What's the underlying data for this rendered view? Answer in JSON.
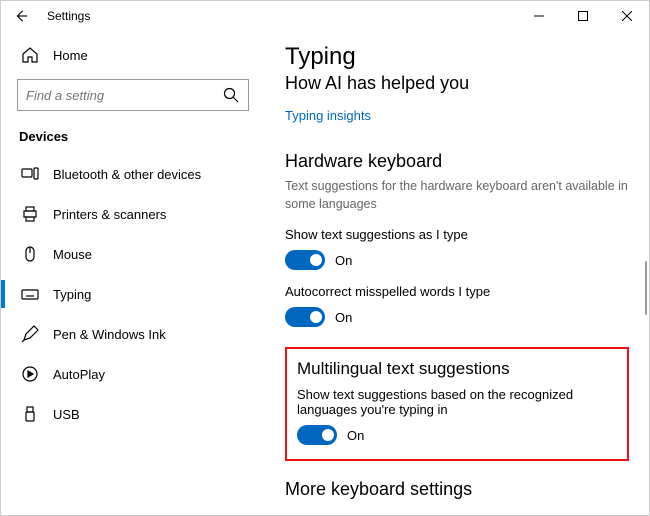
{
  "app": {
    "title": "Settings"
  },
  "sidebar": {
    "home_label": "Home",
    "search_placeholder": "Find a setting",
    "group_title": "Devices",
    "items": [
      {
        "label": "Bluetooth & other devices"
      },
      {
        "label": "Printers & scanners"
      },
      {
        "label": "Mouse"
      },
      {
        "label": "Typing"
      },
      {
        "label": "Pen & Windows Ink"
      },
      {
        "label": "AutoPlay"
      },
      {
        "label": "USB"
      }
    ]
  },
  "page": {
    "title": "Typing",
    "subtitle": "How AI has helped you",
    "insights_link": "Typing insights",
    "hardware": {
      "heading": "Hardware keyboard",
      "note": "Text suggestions for the hardware keyboard aren't available in some languages",
      "suggest_label": "Show text suggestions as I type",
      "suggest_state": "On",
      "autocorrect_label": "Autocorrect misspelled words I type",
      "autocorrect_state": "On"
    },
    "multilingual": {
      "heading": "Multilingual text suggestions",
      "desc": "Show text suggestions based on the recognized languages you're typing in",
      "state": "On"
    },
    "more_heading": "More keyboard settings"
  }
}
